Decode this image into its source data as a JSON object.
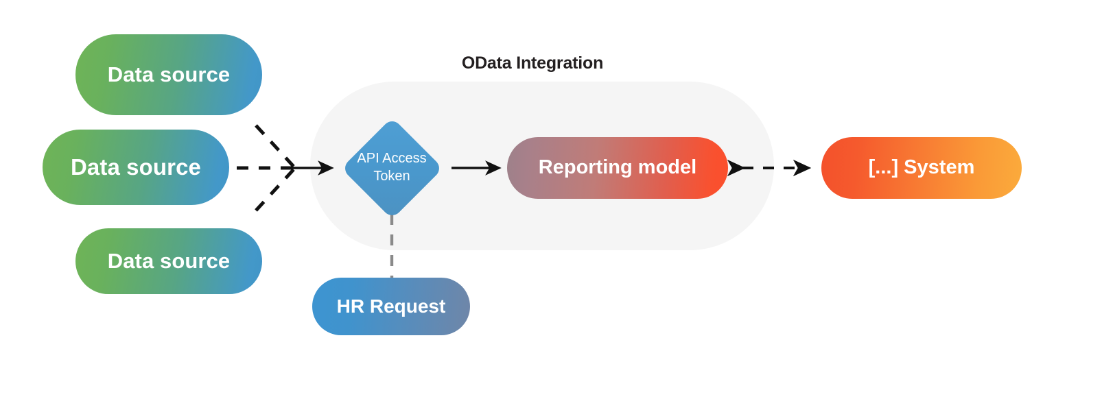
{
  "diagram": {
    "title": "OData Integration",
    "nodes": {
      "data_source_1": "Data source",
      "data_source_2": "Data source",
      "data_source_3": "Data source",
      "api_token_line1": "API Access",
      "api_token_line2": "Token",
      "reporting_model": "Reporting model",
      "external_system": "[...] System",
      "hr_request": "HR Request"
    },
    "colors": {
      "data_source_start": "#6fb457",
      "data_source_end": "#4195c7",
      "diamond_start": "#4f9fd4",
      "diamond_end": "#4c92c2",
      "reporting_model_start": "#9d818a",
      "reporting_model_end": "#fb4f2c",
      "external_system_start": "#f4512c",
      "external_system_end": "#fbab3c",
      "hr_request_start": "#3d94d1",
      "hr_request_end": "#6f86a8",
      "container_background": "#f5f5f5",
      "title_text": "#231f20",
      "connector_solid": "#111111",
      "connector_dashed_grey": "#8a8a8a",
      "page_background": "#ffffff"
    },
    "connectors": [
      {
        "id": "ds1-to-junction",
        "style": "dashed",
        "arrow": "none",
        "from": "data_source_1",
        "to": "junction"
      },
      {
        "id": "ds2-to-junction",
        "style": "dashed",
        "arrow": "none",
        "from": "data_source_2",
        "to": "junction"
      },
      {
        "id": "ds3-to-junction",
        "style": "dashed",
        "arrow": "none",
        "from": "data_source_3",
        "to": "junction"
      },
      {
        "id": "junction-to-token",
        "style": "solid",
        "arrow": "end",
        "from": "junction",
        "to": "api_token"
      },
      {
        "id": "token-to-reporting",
        "style": "solid",
        "arrow": "end",
        "from": "api_token",
        "to": "reporting_model"
      },
      {
        "id": "reporting-to-system",
        "style": "dashed",
        "arrow": "both",
        "from": "reporting_model",
        "to": "external_system"
      },
      {
        "id": "token-to-hr",
        "style": "dashed",
        "arrow": "none",
        "from": "api_token",
        "to": "hr_request"
      }
    ]
  }
}
